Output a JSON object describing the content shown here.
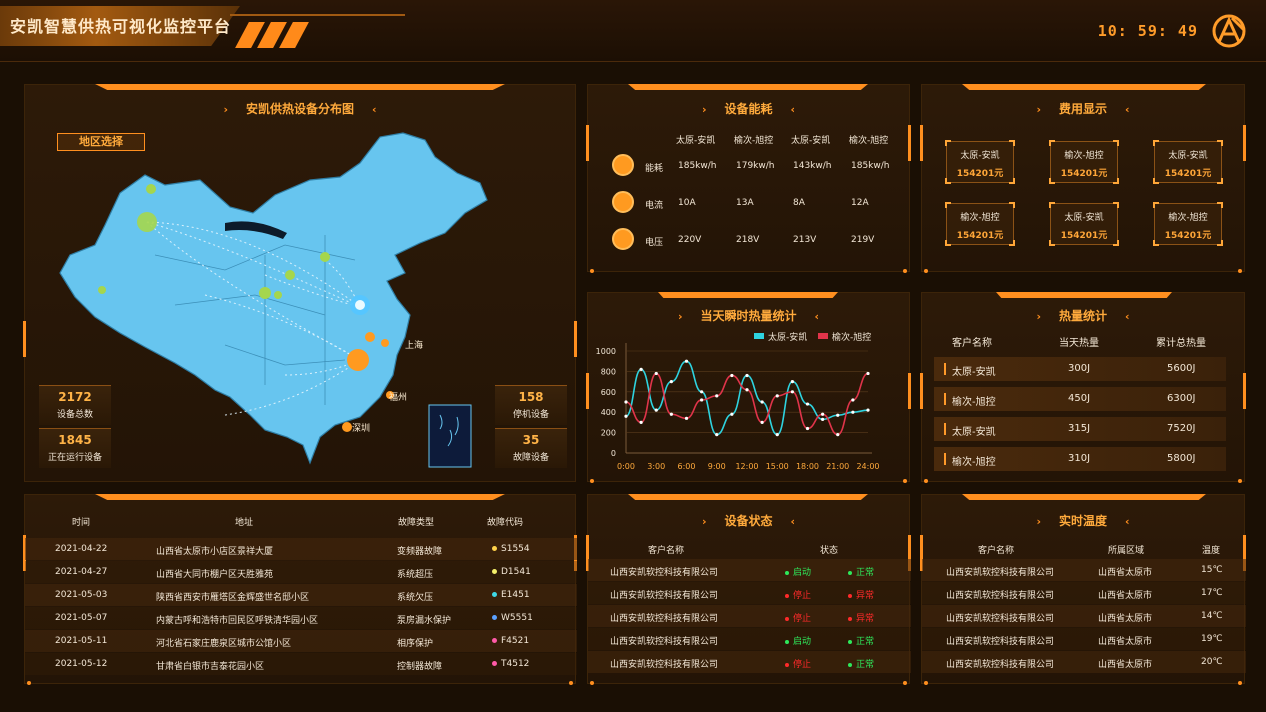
{
  "header": {
    "title": "安凯智慧供热可视化监控平台",
    "clock": "10: 59: 49"
  },
  "colors": {
    "accent": "#ff8f1f",
    "map": "#67c5ef",
    "series1": "#2ed3df",
    "series2": "#e0344a"
  },
  "map_panel": {
    "title": "安凯供热设备分布图",
    "region_button": "地区选择",
    "stats": [
      {
        "value": "2172",
        "label": "设备总数"
      },
      {
        "value": "1845",
        "label": "正在运行设备"
      },
      {
        "value": "158",
        "label": "停机设备"
      },
      {
        "value": "35",
        "label": "故障设备"
      }
    ],
    "city_labels": [
      "上海",
      "福州",
      "深圳"
    ]
  },
  "energy_panel": {
    "title": "设备能耗",
    "columns": [
      "太原-安凯",
      "榆次-旭控",
      "太原-安凯",
      "榆次-旭控"
    ],
    "rows": [
      {
        "label": "能耗",
        "icon": "energy-icon",
        "values": [
          "185kw/h",
          "179kw/h",
          "143kw/h",
          "185kw/h"
        ]
      },
      {
        "label": "电流",
        "icon": "current-icon",
        "values": [
          "10A",
          "13A",
          "8A",
          "12A"
        ]
      },
      {
        "label": "电压",
        "icon": "voltage-icon",
        "values": [
          "220V",
          "218V",
          "213V",
          "219V"
        ]
      }
    ]
  },
  "fee_panel": {
    "title": "费用显示",
    "cards": [
      {
        "name": "太原-安凯",
        "value": "154201元"
      },
      {
        "name": "榆次-旭控",
        "value": "154201元"
      },
      {
        "name": "太原-安凯",
        "value": "154201元"
      },
      {
        "name": "榆次-旭控",
        "value": "154201元"
      },
      {
        "name": "太原-安凯",
        "value": "154201元"
      },
      {
        "name": "榆次-旭控",
        "value": "154201元"
      }
    ]
  },
  "chart_panel": {
    "title": "当天瞬时热量统计"
  },
  "chart_data": {
    "type": "line",
    "x": [
      "0:00",
      "1:30",
      "3:00",
      "4:30",
      "6:00",
      "7:30",
      "9:00",
      "10:30",
      "12:00",
      "13:30",
      "15:00",
      "16:30",
      "18:00",
      "19:30",
      "21:00",
      "22:30",
      "24:00"
    ],
    "x_tick_labels": [
      "0:00",
      "3:00",
      "6:00",
      "9:00",
      "12:00",
      "15:00",
      "18:00",
      "21:00",
      "24:00"
    ],
    "series": [
      {
        "name": "太原-安凯",
        "values": [
          360,
          820,
          420,
          700,
          900,
          600,
          180,
          380,
          760,
          500,
          180,
          700,
          480,
          330,
          370,
          400,
          420
        ]
      },
      {
        "name": "榆次-旭控",
        "values": [
          500,
          300,
          780,
          380,
          340,
          520,
          560,
          760,
          620,
          300,
          560,
          600,
          240,
          380,
          180,
          520,
          780
        ]
      }
    ],
    "ylim": [
      0,
      1000
    ],
    "y_ticks": [
      0,
      200,
      400,
      600,
      800,
      1000
    ],
    "legend": "top-right",
    "grid": true
  },
  "heat_panel": {
    "title": "热量统计",
    "headers": [
      "客户名称",
      "当天热量",
      "累计总热量"
    ],
    "rows": [
      [
        "太原-安凯",
        "300J",
        "5600J"
      ],
      [
        "榆次-旭控",
        "450J",
        "6300J"
      ],
      [
        "太原-安凯",
        "315J",
        "7520J"
      ],
      [
        "榆次-旭控",
        "310J",
        "5800J"
      ]
    ]
  },
  "fault_panel": {
    "headers": [
      "时间",
      "地址",
      "故障类型",
      "故障代码"
    ],
    "rows": [
      {
        "date": "2021-04-22",
        "address": "山西省太原市小店区景祥大厦",
        "type": "变频器故障",
        "code": "S1554",
        "dot": "#ffd24a"
      },
      {
        "date": "2021-04-27",
        "address": "山西省大同市棚户区天胜雅苑",
        "type": "系统超压",
        "code": "D1541",
        "dot": "#f4ef6a"
      },
      {
        "date": "2021-05-03",
        "address": "陕西省西安市雁塔区金辉盛世名邸小区",
        "type": "系统欠压",
        "code": "E1451",
        "dot": "#3fd8e6"
      },
      {
        "date": "2021-05-07",
        "address": "内蒙古呼和浩特市回民区呼铁清华园小区",
        "type": "泵房漏水保护",
        "code": "W5551",
        "dot": "#5aa0ff"
      },
      {
        "date": "2021-05-11",
        "address": "河北省石家庄鹿泉区城市公馆小区",
        "type": "相序保护",
        "code": "F4521",
        "dot": "#ff5aa8"
      },
      {
        "date": "2021-05-12",
        "address": "甘肃省白银市吉泰花园小区",
        "type": "控制器故障",
        "code": "T4512",
        "dot": "#ff5aa8"
      }
    ]
  },
  "status_panel": {
    "title": "设备状态",
    "headers": [
      "客户名称",
      "状态"
    ],
    "rows": [
      {
        "name": "山西安凯软控科技有限公司",
        "run": "启动",
        "health": "正常",
        "ok": true
      },
      {
        "name": "山西安凯软控科技有限公司",
        "run": "停止",
        "health": "异常",
        "ok": false
      },
      {
        "name": "山西安凯软控科技有限公司",
        "run": "停止",
        "health": "异常",
        "ok": false
      },
      {
        "name": "山西安凯软控科技有限公司",
        "run": "启动",
        "health": "正常",
        "ok": true
      },
      {
        "name": "山西安凯软控科技有限公司",
        "run": "停止",
        "health": "正常",
        "ok": true
      }
    ]
  },
  "temp_panel": {
    "title": "实时温度",
    "headers": [
      "客户名称",
      "所属区域",
      "温度"
    ],
    "rows": [
      [
        "山西安凯软控科技有限公司",
        "山西省太原市",
        "15℃"
      ],
      [
        "山西安凯软控科技有限公司",
        "山西省太原市",
        "17℃"
      ],
      [
        "山西安凯软控科技有限公司",
        "山西省太原市",
        "14℃"
      ],
      [
        "山西安凯软控科技有限公司",
        "山西省太原市",
        "19℃"
      ],
      [
        "山西安凯软控科技有限公司",
        "山西省太原市",
        "20℃"
      ]
    ]
  }
}
